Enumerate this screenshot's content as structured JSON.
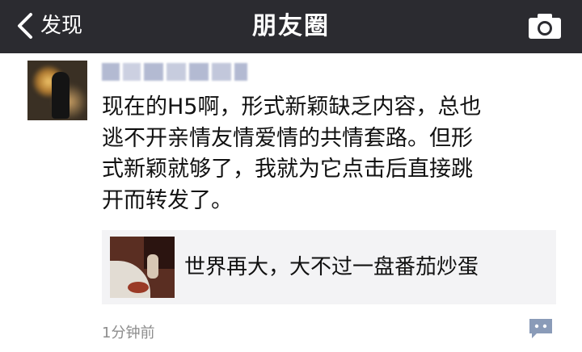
{
  "navbar": {
    "back_label": "发现",
    "title": "朋友圈"
  },
  "post": {
    "username": "",
    "text": "现在的H5啊，形式新颖缺乏内容，总也\n逃不开亲情友情爱情的共情套路。但形\n式新颖就够了，我就为它点击后直接跳\n开而转发了。",
    "link": {
      "title": "世界再大，大不过一盘番茄炒蛋"
    },
    "timestamp": "1分钟前"
  },
  "icons": {
    "back": "chevron-left-icon",
    "camera": "camera-icon",
    "comment": "comment-bubble-icon"
  },
  "colors": {
    "navbar_bg": "#2b2b30",
    "card_bg": "#f3f3f5",
    "comment_icon": "#8a9bb8"
  }
}
